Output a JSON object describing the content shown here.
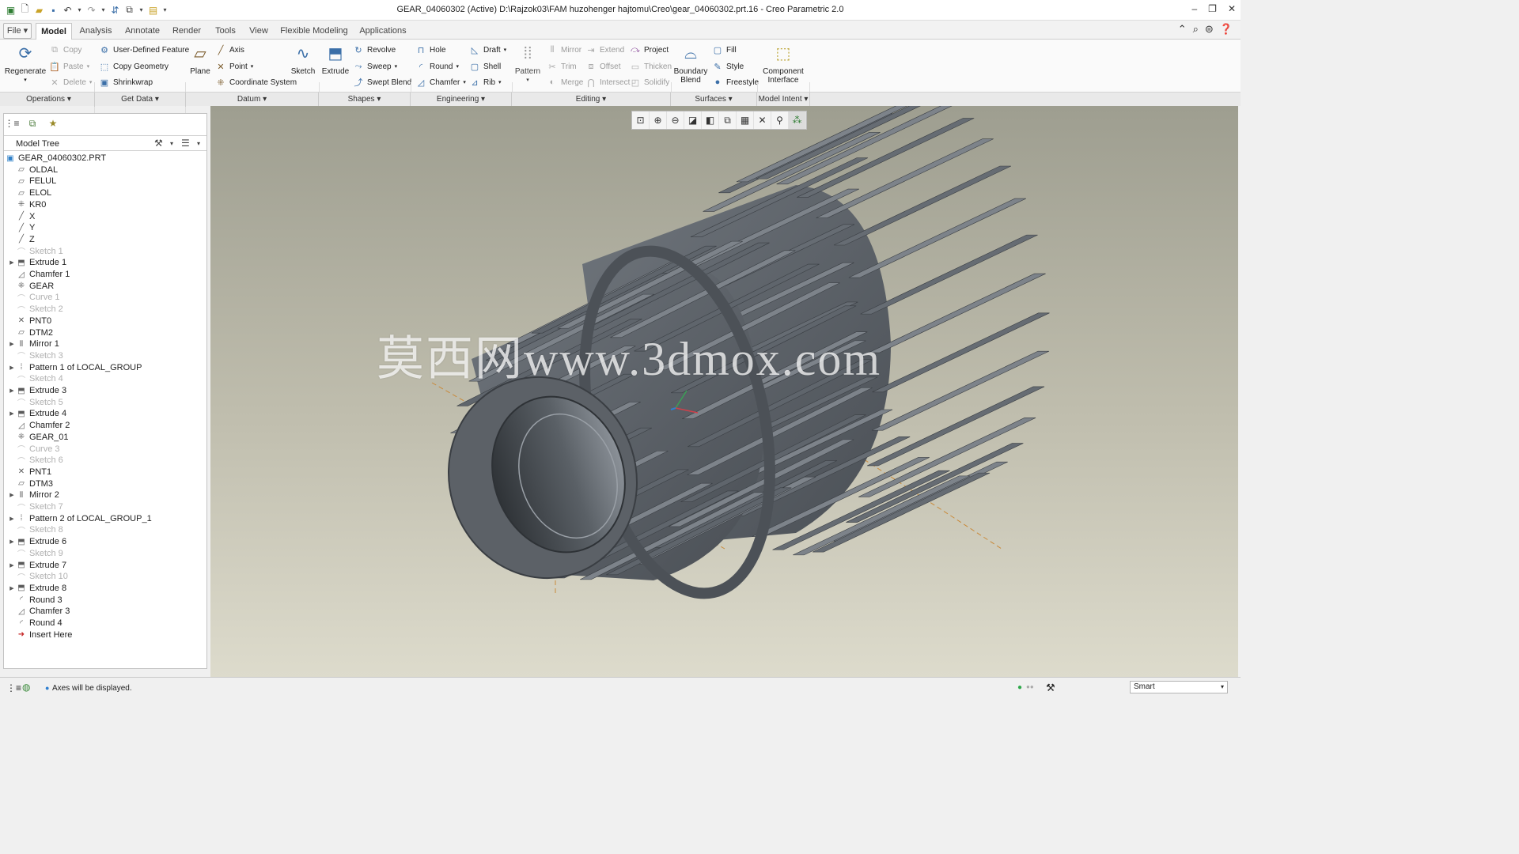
{
  "window": {
    "title": "GEAR_04060302 (Active) D:\\Rajzok03\\FAM huzohenger hajtomu\\Creo\\gear_04060302.prt.16 - Creo Parametric 2.0"
  },
  "menubar": {
    "tabs": [
      {
        "label": "File",
        "name": "file"
      },
      {
        "label": "Model",
        "name": "model",
        "active": true
      },
      {
        "label": "Analysis",
        "name": "analysis"
      },
      {
        "label": "Annotate",
        "name": "annotate"
      },
      {
        "label": "Render",
        "name": "render"
      },
      {
        "label": "Tools",
        "name": "tools"
      },
      {
        "label": "View",
        "name": "view"
      },
      {
        "label": "Flexible Modeling",
        "name": "flexible-modeling"
      },
      {
        "label": "Applications",
        "name": "applications"
      }
    ]
  },
  "ribbon": {
    "regenerate": "Regenerate",
    "copy": "Copy",
    "paste": "Paste",
    "delete": "Delete",
    "user_defined_feature": "User-Defined Feature",
    "copy_geometry": "Copy Geometry",
    "shrinkwrap": "Shrinkwrap",
    "plane": "Plane",
    "axis": "Axis",
    "point": "Point",
    "coordinate_system": "Coordinate System",
    "sketch": "Sketch",
    "extrude": "Extrude",
    "revolve": "Revolve",
    "sweep": "Sweep",
    "swept_blend": "Swept Blend",
    "hole": "Hole",
    "round": "Round",
    "chamfer": "Chamfer",
    "draft": "Draft",
    "shell": "Shell",
    "rib": "Rib",
    "pattern": "Pattern",
    "mirror": "Mirror",
    "trim": "Trim",
    "merge": "Merge",
    "extend": "Extend",
    "offset": "Offset",
    "intersect": "Intersect",
    "project": "Project",
    "thicken": "Thicken",
    "solidify": "Solidify",
    "boundary_blend": "Boundary Blend",
    "fill": "Fill",
    "style": "Style",
    "freestyle": "Freestyle",
    "component_interface": "Component Interface",
    "groups": [
      {
        "label": "Operations"
      },
      {
        "label": "Get Data"
      },
      {
        "label": "Datum"
      },
      {
        "label": "Shapes"
      },
      {
        "label": "Engineering"
      },
      {
        "label": "Editing"
      },
      {
        "label": "Surfaces"
      },
      {
        "label": "Model Intent"
      }
    ]
  },
  "model_tree": {
    "title": "Model Tree",
    "items": [
      {
        "label": "GEAR_04060302.PRT",
        "icon": "part-icon",
        "expandable": false,
        "dim": false,
        "indent": 0
      },
      {
        "label": "OLDAL",
        "icon": "datum-plane-icon",
        "expandable": false,
        "dim": false,
        "indent": 1
      },
      {
        "label": "FELUL",
        "icon": "datum-plane-icon",
        "expandable": false,
        "dim": false,
        "indent": 1
      },
      {
        "label": "ELOL",
        "icon": "datum-plane-icon",
        "expandable": false,
        "dim": false,
        "indent": 1
      },
      {
        "label": "KR0",
        "icon": "coordinate-system-icon",
        "expandable": false,
        "dim": false,
        "indent": 1
      },
      {
        "label": "X",
        "icon": "axis-icon",
        "expandable": false,
        "dim": false,
        "indent": 1
      },
      {
        "label": "Y",
        "icon": "axis-icon",
        "expandable": false,
        "dim": false,
        "indent": 1
      },
      {
        "label": "Z",
        "icon": "axis-icon",
        "expandable": false,
        "dim": false,
        "indent": 1
      },
      {
        "label": "Sketch 1",
        "icon": "sketch-icon",
        "expandable": false,
        "dim": true,
        "indent": 1
      },
      {
        "label": "Extrude 1",
        "icon": "extrude-icon",
        "expandable": true,
        "dim": false,
        "indent": 1
      },
      {
        "label": "Chamfer 1",
        "icon": "chamfer-icon",
        "expandable": false,
        "dim": false,
        "indent": 1
      },
      {
        "label": "GEAR",
        "icon": "coordinate-system-icon",
        "expandable": false,
        "dim": false,
        "indent": 1
      },
      {
        "label": "Curve 1",
        "icon": "sketch-icon",
        "expandable": false,
        "dim": true,
        "indent": 1
      },
      {
        "label": "Sketch 2",
        "icon": "sketch-icon",
        "expandable": false,
        "dim": true,
        "indent": 1
      },
      {
        "label": "PNT0",
        "icon": "datum-point-icon",
        "expandable": false,
        "dim": false,
        "indent": 1
      },
      {
        "label": "DTM2",
        "icon": "datum-plane-icon",
        "expandable": false,
        "dim": false,
        "indent": 1
      },
      {
        "label": "Mirror 1",
        "icon": "mirror-icon",
        "expandable": true,
        "dim": false,
        "indent": 1
      },
      {
        "label": "Sketch 3",
        "icon": "sketch-icon",
        "expandable": false,
        "dim": true,
        "indent": 1
      },
      {
        "label": "Pattern 1 of LOCAL_GROUP",
        "icon": "pattern-icon",
        "expandable": true,
        "dim": false,
        "indent": 1
      },
      {
        "label": "Sketch 4",
        "icon": "sketch-icon",
        "expandable": false,
        "dim": true,
        "indent": 1
      },
      {
        "label": "Extrude 3",
        "icon": "extrude-icon",
        "expandable": true,
        "dim": false,
        "indent": 1
      },
      {
        "label": "Sketch 5",
        "icon": "sketch-icon",
        "expandable": false,
        "dim": true,
        "indent": 1
      },
      {
        "label": "Extrude 4",
        "icon": "extrude-icon",
        "expandable": true,
        "dim": false,
        "indent": 1
      },
      {
        "label": "Chamfer 2",
        "icon": "chamfer-icon",
        "expandable": false,
        "dim": false,
        "indent": 1
      },
      {
        "label": "GEAR_01",
        "icon": "coordinate-system-icon",
        "expandable": false,
        "dim": false,
        "indent": 1
      },
      {
        "label": "Curve 3",
        "icon": "sketch-icon",
        "expandable": false,
        "dim": true,
        "indent": 1
      },
      {
        "label": "Sketch 6",
        "icon": "sketch-icon",
        "expandable": false,
        "dim": true,
        "indent": 1
      },
      {
        "label": "PNT1",
        "icon": "datum-point-icon",
        "expandable": false,
        "dim": false,
        "indent": 1
      },
      {
        "label": "DTM3",
        "icon": "datum-plane-icon",
        "expandable": false,
        "dim": false,
        "indent": 1
      },
      {
        "label": "Mirror 2",
        "icon": "mirror-icon",
        "expandable": true,
        "dim": false,
        "indent": 1
      },
      {
        "label": "Sketch 7",
        "icon": "sketch-icon",
        "expandable": false,
        "dim": true,
        "indent": 1
      },
      {
        "label": "Pattern 2 of LOCAL_GROUP_1",
        "icon": "pattern-icon",
        "expandable": true,
        "dim": false,
        "indent": 1
      },
      {
        "label": "Sketch 8",
        "icon": "sketch-icon",
        "expandable": false,
        "dim": true,
        "indent": 1
      },
      {
        "label": "Extrude 6",
        "icon": "extrude-icon",
        "expandable": true,
        "dim": false,
        "indent": 1
      },
      {
        "label": "Sketch 9",
        "icon": "sketch-icon",
        "expandable": false,
        "dim": true,
        "indent": 1
      },
      {
        "label": "Extrude 7",
        "icon": "extrude-icon",
        "expandable": true,
        "dim": false,
        "indent": 1
      },
      {
        "label": "Sketch 10",
        "icon": "sketch-icon",
        "expandable": false,
        "dim": true,
        "indent": 1
      },
      {
        "label": "Extrude 8",
        "icon": "extrude-icon",
        "expandable": true,
        "dim": false,
        "indent": 1
      },
      {
        "label": "Round 3",
        "icon": "round-icon",
        "expandable": false,
        "dim": false,
        "indent": 1
      },
      {
        "label": "Chamfer 3",
        "icon": "chamfer-icon",
        "expandable": false,
        "dim": false,
        "indent": 1
      },
      {
        "label": "Round 4",
        "icon": "round-icon",
        "expandable": false,
        "dim": false,
        "indent": 1
      },
      {
        "label": "Insert Here",
        "icon": "insert-here-icon",
        "expandable": false,
        "dim": false,
        "indent": 1
      }
    ]
  },
  "watermark": "莫西网www.3dmox.com",
  "status": {
    "message": "Axes will be displayed.",
    "filter": "Smart"
  },
  "colors": {
    "gear_face": "#5f646a",
    "gear_dark": "#3f4348",
    "gear_light": "#8a9097",
    "viewport_top": "#9e9e90",
    "viewport_bottom": "#dddbcc"
  }
}
